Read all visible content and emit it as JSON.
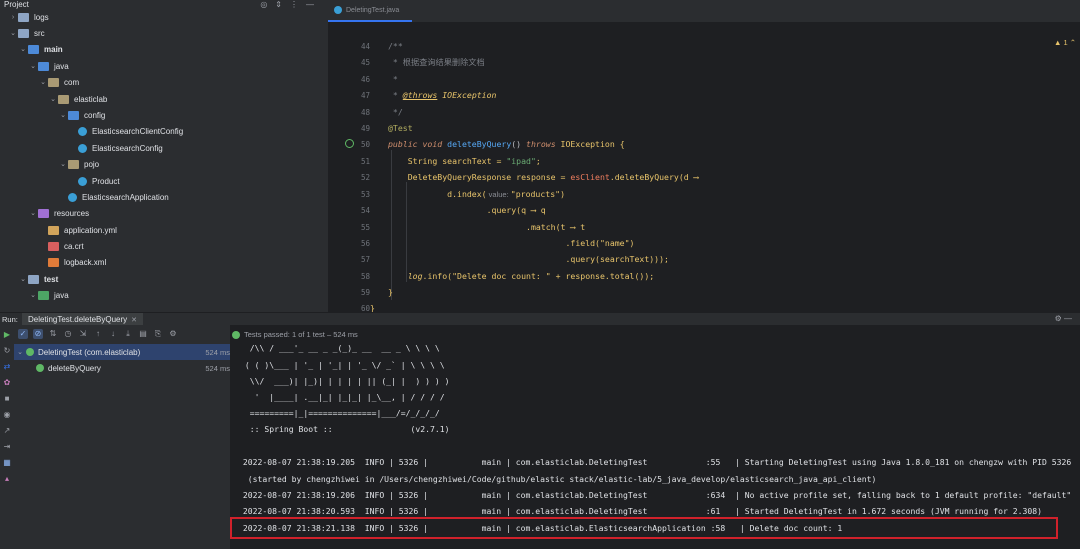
{
  "project": {
    "title": "Project",
    "tree": [
      {
        "label": "logs",
        "icon": "folder",
        "arrow": "›",
        "bold": false
      },
      {
        "label": "src",
        "icon": "folder",
        "arrow": "⌄",
        "bold": false
      },
      {
        "label": "main",
        "icon": "folder-src",
        "arrow": "⌄",
        "bold": true
      },
      {
        "label": "java",
        "icon": "folder-src",
        "arrow": "⌄",
        "bold": false
      },
      {
        "label": "com",
        "icon": "pkg",
        "arrow": "⌄",
        "bold": false
      },
      {
        "label": "elasticlab",
        "icon": "pkg",
        "arrow": "⌄",
        "bold": false
      },
      {
        "label": "config",
        "icon": "folder-src",
        "arrow": "⌄",
        "bold": false
      },
      {
        "label": "ElasticsearchClientConfig",
        "icon": "cls",
        "arrow": "",
        "bold": false
      },
      {
        "label": "ElasticsearchConfig",
        "icon": "cls",
        "arrow": "",
        "bold": false
      },
      {
        "label": "pojo",
        "icon": "pkg",
        "arrow": "⌄",
        "bold": false
      },
      {
        "label": "Product",
        "icon": "cls",
        "arrow": "",
        "bold": false
      },
      {
        "label": "ElasticsearchApplication",
        "icon": "app",
        "arrow": "",
        "bold": false
      },
      {
        "label": "resources",
        "icon": "folder-res",
        "arrow": "⌄",
        "bold": false
      },
      {
        "label": "application.yml",
        "icon": "yml",
        "arrow": "",
        "bold": false
      },
      {
        "label": "ca.crt",
        "icon": "crt",
        "arrow": "",
        "bold": false
      },
      {
        "label": "logback.xml",
        "icon": "xml",
        "arrow": "",
        "bold": false
      },
      {
        "label": "test",
        "icon": "folder",
        "arrow": "⌄",
        "bold": true
      },
      {
        "label": "java",
        "icon": "folder-test",
        "arrow": "⌄",
        "bold": false
      }
    ]
  },
  "editor": {
    "tab": "DeletingTest.java",
    "warning": "▲ 1 ⌃",
    "line_numbers": [
      "44",
      "45",
      "46",
      "47",
      "48",
      "49",
      "50",
      "51",
      "52",
      "53",
      "54",
      "55",
      "56",
      "57",
      "58",
      "59",
      "60"
    ]
  },
  "run": {
    "label": "Run:",
    "tab": "DeletingTest.deleteByQuery",
    "status": "Tests passed: 1 of 1 test – 524 ms",
    "tree": [
      {
        "label": "DeletingTest (com.elasticlab)",
        "time": "524 ms"
      },
      {
        "label": "deleteByQuery",
        "time": "524 ms"
      }
    ],
    "banner": [
      "  /\\\\ / ___'_ __ _ _(_)_ __  __ _ \\ \\ \\ \\",
      " ( ( )\\___ | '_ | '_| | '_ \\/ _` | \\ \\ \\ \\",
      "  \\\\/  ___)| |_)| | | | | || (_| |  ) ) ) )",
      "   '  |____| .__|_| |_|_| |_\\__, | / / / /",
      "  =========|_|==============|___/=/_/_/_/",
      "  :: Spring Boot ::                (v2.7.1)"
    ],
    "log": [
      " 2022-08-07 21:38:19.205  INFO | 5326 |           main | com.elasticlab.DeletingTest            :55   | Starting DeletingTest using Java 1.8.0_181 on chengzw with PID 5326",
      "  (started by chengzhiwei in /Users/chengzhiwei/Code/github/elastic stack/elastic-lab/5_java_develop/elasticsearch_java_api_client)",
      " 2022-08-07 21:38:19.206  INFO | 5326 |           main | com.elasticlab.DeletingTest            :634  | No active profile set, falling back to 1 default profile: \"default\"",
      " 2022-08-07 21:38:20.593  INFO | 5326 |           main | com.elasticlab.DeletingTest            :61   | Started DeletingTest in 1.672 seconds (JVM running for 2.308)",
      " 2022-08-07 21:38:21.138  INFO | 5326 |           main | com.elasticlab.ElasticsearchApplication :58   | Delete doc count: 1"
    ]
  },
  "code": {
    "l44": "/**",
    "l45": " * 根据查询结果删除文档",
    "l46": " *",
    "l47_pre": " * ",
    "l47_tag": "@throws",
    "l47_ex": " IOException",
    "l48": " */",
    "l49": "@Test",
    "l50_a": "public void",
    "l50_fn": " deleteByQuery",
    "l50_b": "() ",
    "l50_c": "throws",
    "l50_d": " IOException {",
    "l51_a": "    String searchText = ",
    "l51_s": "\"ipad\"",
    "l51_e": ";",
    "l52_a": "    DeleteByQueryResponse response = ",
    "l52_f": "esClient",
    "l52_b": ".deleteByQuery(d ⟶",
    "l53_a": "            d.index(",
    "l53_h": " value: ",
    "l53_s": "\"products\"",
    "l53_e": ")",
    "l54": "                    .query(q ⟶ q",
    "l55": "                            .match(t ⟶ t",
    "l56_a": "                                    .field(",
    "l56_s": "\"name\"",
    "l56_e": ")",
    "l57": "                                    .query(searchText)));",
    "l58_a": "    ",
    "l58_f": "log",
    "l58_b": ".info(",
    "l58_s": "\"Delete doc count: \"",
    "l58_e": " + response.total());",
    "l59": "}",
    "l60": "}"
  }
}
